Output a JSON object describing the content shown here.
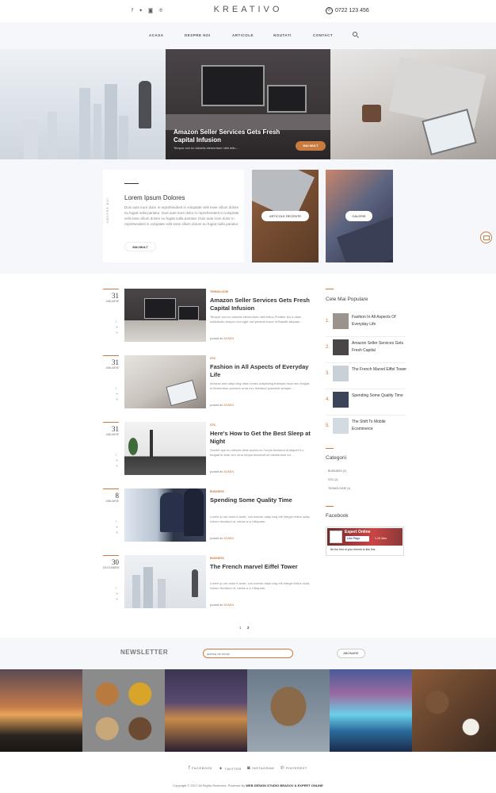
{
  "header": {
    "logo": "KREATIVO",
    "phone": "0722 123 456",
    "social_icons": [
      "facebook-icon",
      "twitter-icon",
      "instagram-icon",
      "pinterest-icon"
    ]
  },
  "nav": {
    "items": [
      "ACASA",
      "DESPRE NOI",
      "ARTICOLE",
      "NOUTATI",
      "CONTACT"
    ]
  },
  "hero": {
    "title": "Amazon Seller Services Gets Fresh Capital Infusion",
    "subtitle": "Tempor orci eu lobortis elementum nibh tellu...",
    "button": "MAI MULT"
  },
  "about": {
    "vertical_label": "DESPRE NOI",
    "title": "Lorem Ipsum Dolores",
    "text": "Duis aute irure dolor in reprehenderit in voluptate velit esse cillum dolore eu fugiat nulla pariatur. Duis aute irure dolor in reprehenderit in voluptate velit esse cillum dolore eu fugiat nulla pariatur. Duis aute irure dolor in reprehenderit in voluptate velit esse cillum dolore eu fugiat nulla pariatur.",
    "button": "MAI MULT",
    "tile_buttons": [
      "ARTICOLE RECENTE",
      "GALERIE"
    ]
  },
  "posts": [
    {
      "day": "31",
      "month": "IANUARIE",
      "category": "TEHNOLOGIE",
      "title": "Amazon Seller Services Gets Fresh Capital Infusion",
      "excerpt": "Tempor orci eu lobortis elementum nibh tellus Porttitor leo a diam sollicitudin tempor orci eget nisl pretium fusce id Blandit aliquam...",
      "by": "postat de",
      "author": "ADMIN"
    },
    {
      "day": "31",
      "month": "IANUARIE",
      "category": "STIL",
      "title": "Fashion in All Aspects of Everyday Life",
      "excerpt": "Aenean sed adipi cing diam donec adipiscing tristique risus nec feugiat in fermentum posuere urna nec tincidunt praesent semper...",
      "by": "postat de",
      "author": "ADMIN"
    },
    {
      "day": "31",
      "month": "IANUARIE",
      "category": "STIL",
      "title": "Here's How to Get the Best Sleep at Night",
      "excerpt": "Sceleri que eu ultrices vitae auctor eu Turpis tincidunt id aliquet ri u feugiat in ante nec urna neque tincidunt mi elementum eu...",
      "by": "postat de",
      "author": "ADMIN"
    },
    {
      "day": "8",
      "month": "IANUARIE",
      "category": "BUSINESS",
      "title": "Spending Some Quality Time",
      "excerpt": "Lorem ip um dolor it amet, con ectetur adipi cing elit Integer tellus nulla, rutrum tincidunt ut, varius a a t Aliquam...",
      "by": "postat de",
      "author": "ADMIN"
    },
    {
      "day": "30",
      "month": "DECEMBRIE",
      "category": "BUSINESS",
      "title": "The French marvel Eiffel Tower",
      "excerpt": "Lorem ip um dolor it amet, con ectetur adipi cing elit Integer tellus nulla, rutrum tincidunt ut, varius a a t Aliquam...",
      "by": "postat de",
      "author": "ADMIN"
    }
  ],
  "sidebar": {
    "popular_title": "Cele Mai Populare",
    "popular": [
      {
        "n": "1.",
        "title": "Fashion In All Aspects Of Everyday Life"
      },
      {
        "n": "2.",
        "title": "Amazon Seller Services Gets Fresh Capital"
      },
      {
        "n": "3.",
        "title": "The French Marvel Eiffel Tower"
      },
      {
        "n": "4.",
        "title": "Spending Some Quality Time"
      },
      {
        "n": "5.",
        "title": "The Shift To Mobile Ecommerce"
      }
    ],
    "categories_title": "Categorii",
    "categories": [
      "BUSINESS (2)",
      "STIL (2)",
      "TEHNOLOGIE (1)"
    ],
    "facebook_title": "Facebook",
    "fb_page": "Expert Online",
    "fb_like": "Like Page",
    "fb_likes": "1.2K likes",
    "fb_text": "Be the first of your friends to like this"
  },
  "pagination": [
    "1",
    "2"
  ],
  "newsletter": {
    "title": "NEWSLETTER",
    "placeholder": "adresa de email",
    "button": "ABONARE"
  },
  "footer": {
    "social": [
      "FACEBOOK",
      "TWITTER",
      "INSTAGRAM",
      "PINTEREST"
    ],
    "copyright": "Copyright © 2017 All Rights Reserved. Powered By",
    "credit": "WEB DESIGN STUDIO BRASOV & EXPERT ONLINE"
  }
}
